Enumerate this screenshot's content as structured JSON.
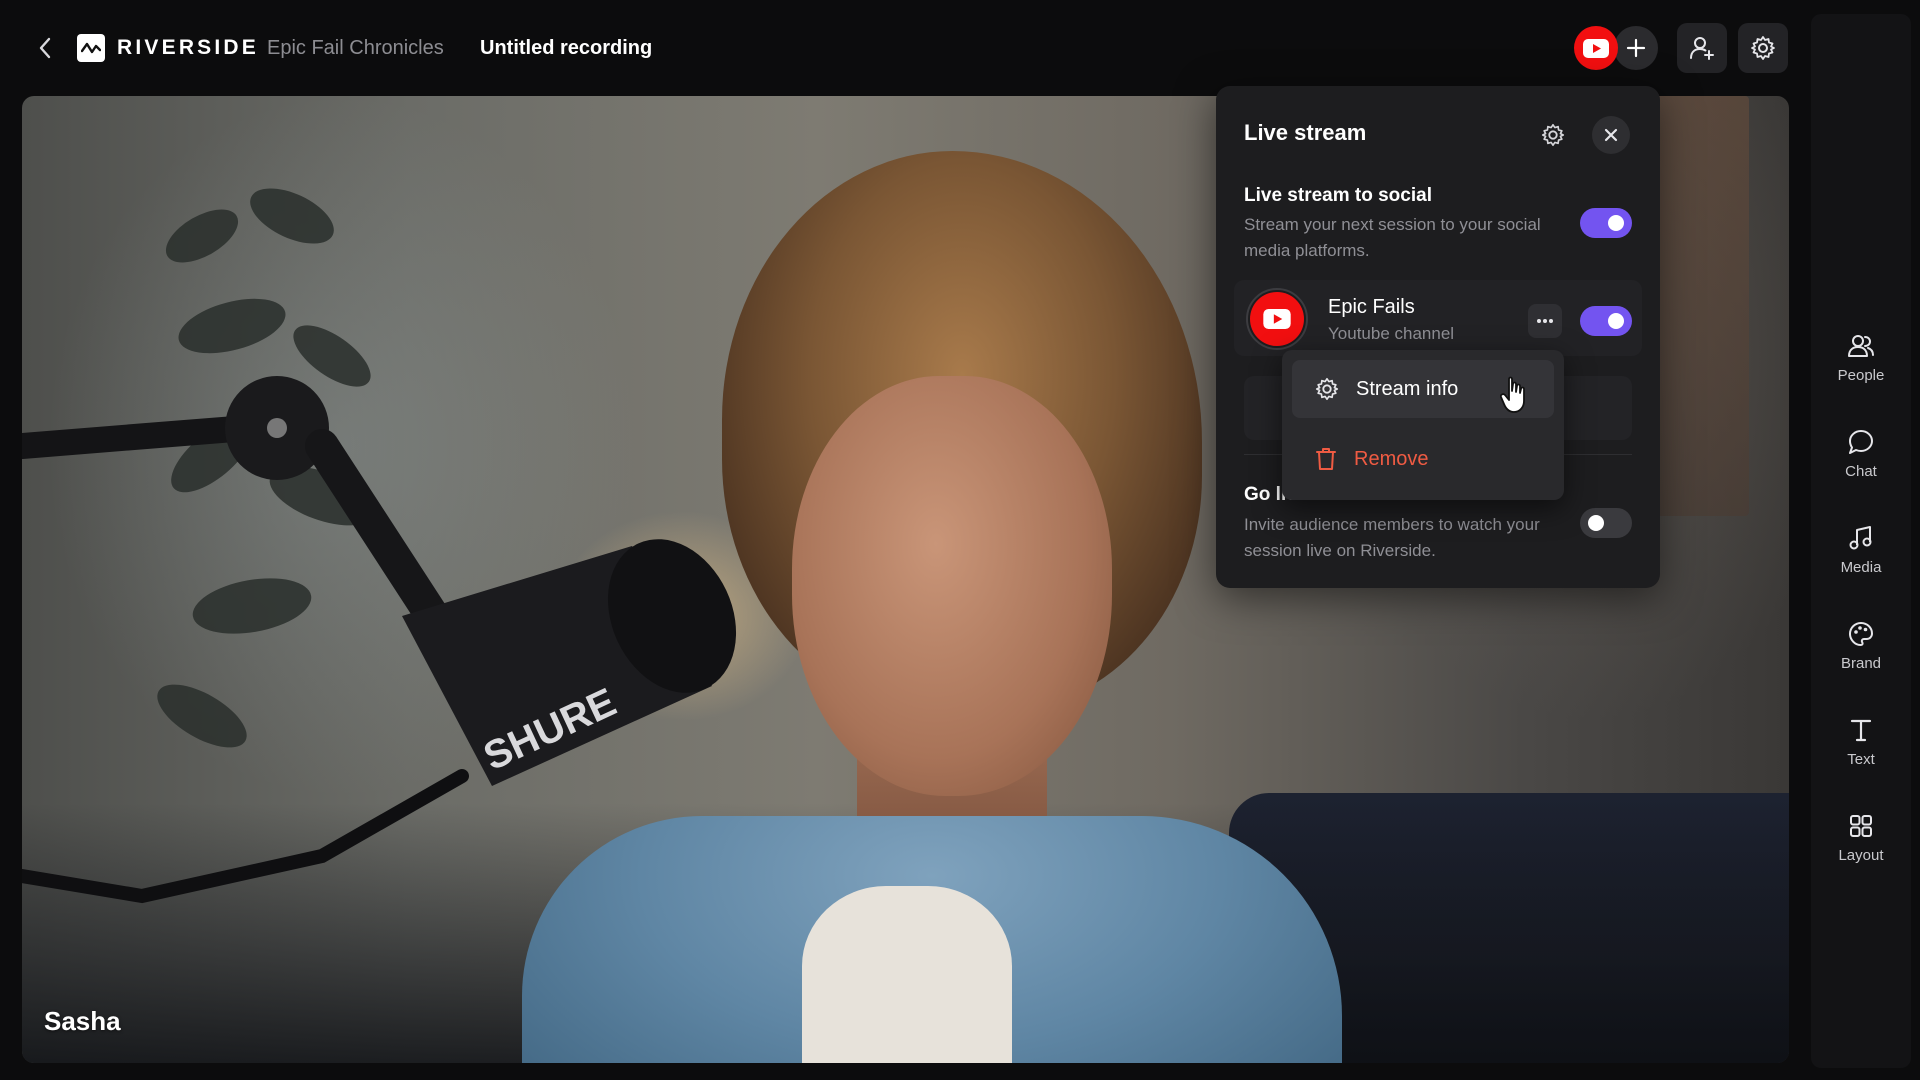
{
  "topbar": {
    "brand": "RIVERSIDE",
    "project": "Epic Fail Chronicles",
    "recording_title": "Untitled recording"
  },
  "stage": {
    "participant_name": "Sasha",
    "mic_brand": "SHURE"
  },
  "siderail": {
    "items": [
      {
        "label": "People",
        "icon": "people-icon"
      },
      {
        "label": "Chat",
        "icon": "chat-icon"
      },
      {
        "label": "Media",
        "icon": "music-note-icon"
      },
      {
        "label": "Brand",
        "icon": "palette-icon"
      },
      {
        "label": "Text",
        "icon": "text-icon"
      },
      {
        "label": "Layout",
        "icon": "grid-icon"
      }
    ]
  },
  "live_panel": {
    "title": "Live stream",
    "social": {
      "title": "Live stream to social",
      "description": "Stream your next session to your social media platforms.",
      "enabled": true
    },
    "channel": {
      "name": "Epic Fails",
      "subtitle": "Youtube channel",
      "enabled": true
    },
    "riverside": {
      "title": "Go live on Riverside",
      "description": "Invite audience members to watch your session live on Riverside.",
      "enabled": false
    },
    "menu": {
      "stream_info": "Stream info",
      "remove": "Remove"
    }
  },
  "colors": {
    "accent": "#7354f0",
    "youtube": "#f20f10",
    "danger": "#ef5b43"
  }
}
